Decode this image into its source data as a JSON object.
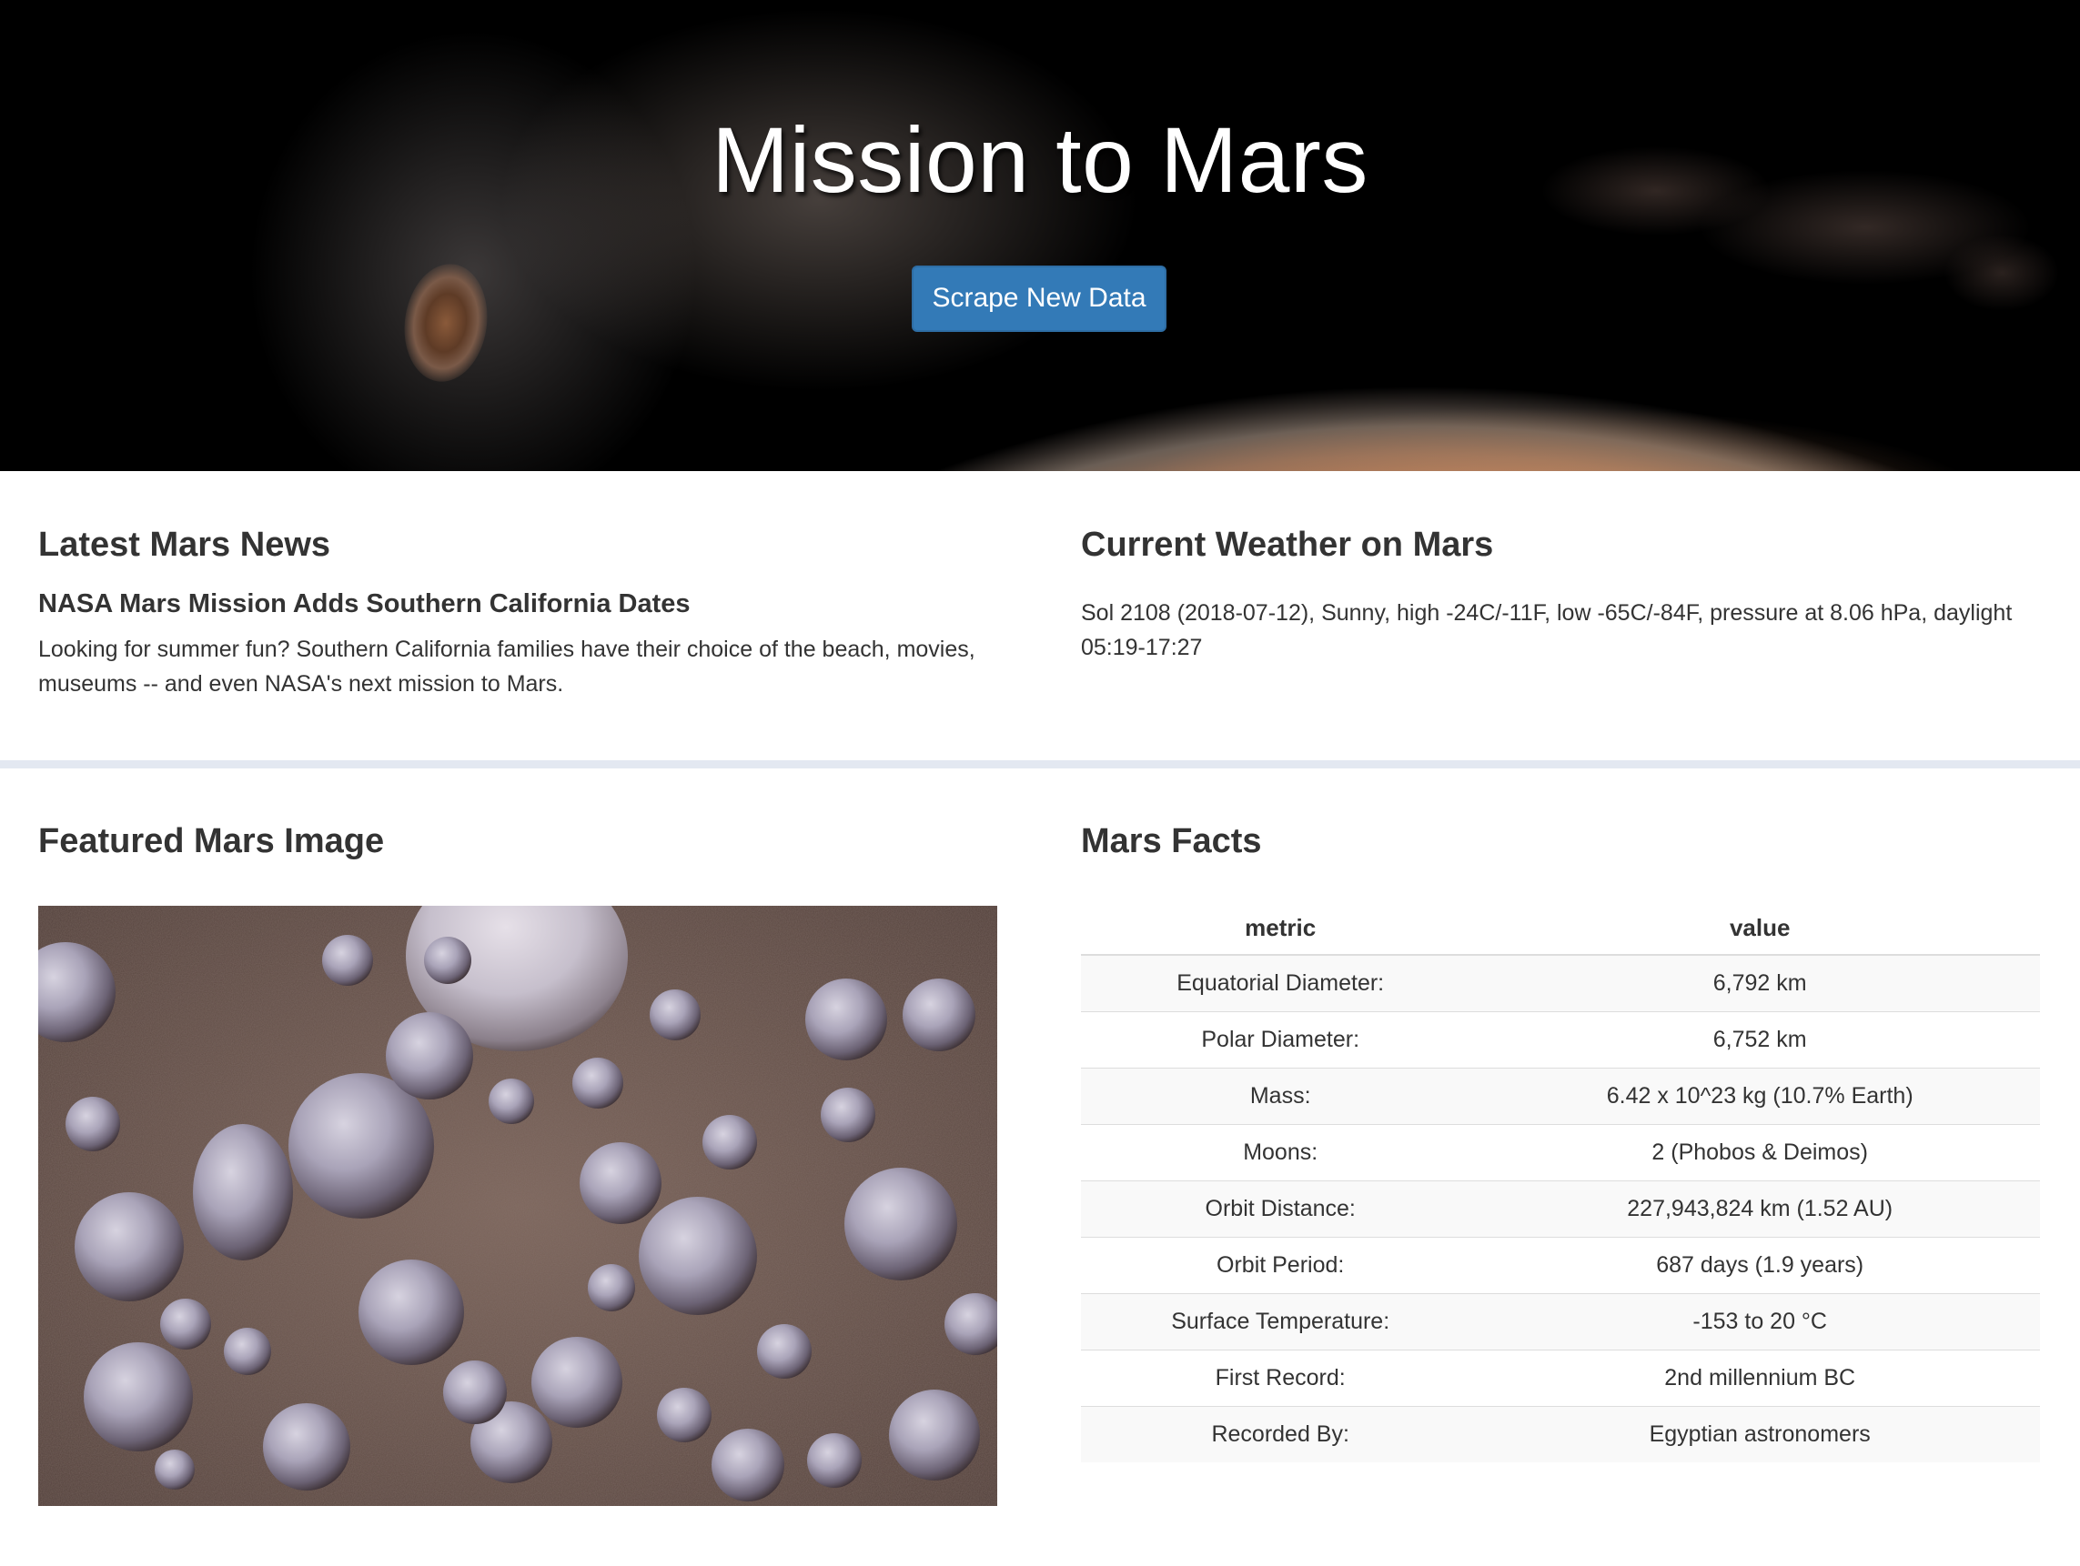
{
  "hero": {
    "title": "Mission to Mars",
    "scrape_button_label": "Scrape New Data"
  },
  "news": {
    "heading": "Latest Mars News",
    "title": "NASA Mars Mission Adds Southern California Dates",
    "paragraph": "Looking for summer fun? Southern California families have their choice of the beach, movies, museums -- and even NASA's next mission to Mars."
  },
  "weather": {
    "heading": "Current Weather on Mars",
    "text": "Sol 2108 (2018-07-12), Sunny, high -24C/-11F, low -65C/-84F, pressure at 8.06 hPa, daylight 05:19-17:27"
  },
  "featured_image": {
    "heading": "Featured Mars Image"
  },
  "facts": {
    "heading": "Mars Facts",
    "columns": [
      "metric",
      "value"
    ],
    "rows": [
      {
        "metric": "Equatorial Diameter:",
        "value": "6,792 km"
      },
      {
        "metric": "Polar Diameter:",
        "value": "6,752 km"
      },
      {
        "metric": "Mass:",
        "value": "6.42 x 10^23 kg (10.7% Earth)"
      },
      {
        "metric": "Moons:",
        "value": "2 (Phobos & Deimos)"
      },
      {
        "metric": "Orbit Distance:",
        "value": "227,943,824 km (1.52 AU)"
      },
      {
        "metric": "Orbit Period:",
        "value": "687 days (1.9 years)"
      },
      {
        "metric": "Surface Temperature:",
        "value": "-153 to 20 °C"
      },
      {
        "metric": "First Record:",
        "value": "2nd millennium BC"
      },
      {
        "metric": "Recorded By:",
        "value": "Egyptian astronomers"
      }
    ]
  },
  "colors": {
    "button": "#337ab7",
    "divider": "#e3e8f1",
    "text": "#333333"
  }
}
